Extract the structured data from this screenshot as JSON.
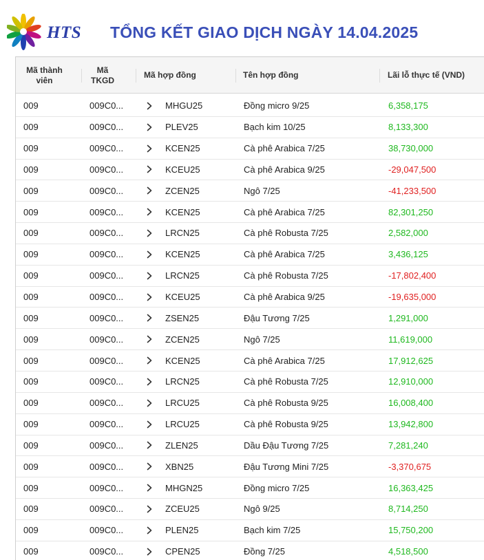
{
  "header": {
    "logo_text": "HTS",
    "title": "TỔNG KẾT GIAO DỊCH NGÀY 14.04.2025"
  },
  "colors": {
    "positive": "#1eb81e",
    "negative": "#e02020",
    "title": "#3a4fb8"
  },
  "table": {
    "headers": {
      "member": "Mã thành viên",
      "account": "Mã TKGD",
      "contract_code": "Mã hợp đồng",
      "contract_name": "Tên hợp đồng",
      "pnl": "Lãi lỗ thực tế (VND)"
    },
    "rows": [
      {
        "member": "009",
        "account": "009C0...",
        "code": "MHGU25",
        "name": "Đồng micro 9/25",
        "pnl": "6,358,175",
        "sign": "pos"
      },
      {
        "member": "009",
        "account": "009C0...",
        "code": "PLEV25",
        "name": "Bạch kim 10/25",
        "pnl": "8,133,300",
        "sign": "pos"
      },
      {
        "member": "009",
        "account": "009C0...",
        "code": "KCEN25",
        "name": "Cà phê Arabica 7/25",
        "pnl": "38,730,000",
        "sign": "pos"
      },
      {
        "member": "009",
        "account": "009C0...",
        "code": "KCEU25",
        "name": "Cà phê Arabica 9/25",
        "pnl": "-29,047,500",
        "sign": "neg"
      },
      {
        "member": "009",
        "account": "009C0...",
        "code": "ZCEN25",
        "name": "Ngô 7/25",
        "pnl": "-41,233,500",
        "sign": "neg"
      },
      {
        "member": "009",
        "account": "009C0...",
        "code": "KCEN25",
        "name": "Cà phê Arabica 7/25",
        "pnl": "82,301,250",
        "sign": "pos"
      },
      {
        "member": "009",
        "account": "009C0...",
        "code": "LRCN25",
        "name": "Cà phê Robusta 7/25",
        "pnl": "2,582,000",
        "sign": "pos"
      },
      {
        "member": "009",
        "account": "009C0...",
        "code": "KCEN25",
        "name": "Cà phê Arabica 7/25",
        "pnl": "3,436,125",
        "sign": "pos"
      },
      {
        "member": "009",
        "account": "009C0...",
        "code": "LRCN25",
        "name": "Cà phê Robusta 7/25",
        "pnl": "-17,802,400",
        "sign": "neg"
      },
      {
        "member": "009",
        "account": "009C0...",
        "code": "KCEU25",
        "name": "Cà phê Arabica 9/25",
        "pnl": "-19,635,000",
        "sign": "neg"
      },
      {
        "member": "009",
        "account": "009C0...",
        "code": "ZSEN25",
        "name": "Đậu Tương 7/25",
        "pnl": "1,291,000",
        "sign": "pos"
      },
      {
        "member": "009",
        "account": "009C0...",
        "code": "ZCEN25",
        "name": "Ngô 7/25",
        "pnl": "11,619,000",
        "sign": "pos"
      },
      {
        "member": "009",
        "account": "009C0...",
        "code": "KCEN25",
        "name": "Cà phê Arabica 7/25",
        "pnl": "17,912,625",
        "sign": "pos"
      },
      {
        "member": "009",
        "account": "009C0...",
        "code": "LRCN25",
        "name": "Cà phê Robusta 7/25",
        "pnl": "12,910,000",
        "sign": "pos"
      },
      {
        "member": "009",
        "account": "009C0...",
        "code": "LRCU25",
        "name": "Cà phê Robusta 9/25",
        "pnl": "16,008,400",
        "sign": "pos"
      },
      {
        "member": "009",
        "account": "009C0...",
        "code": "LRCU25",
        "name": "Cà phê Robusta 9/25",
        "pnl": "13,942,800",
        "sign": "pos"
      },
      {
        "member": "009",
        "account": "009C0...",
        "code": "ZLEN25",
        "name": "Dầu Đậu Tương 7/25",
        "pnl": "7,281,240",
        "sign": "pos"
      },
      {
        "member": "009",
        "account": "009C0...",
        "code": "XBN25",
        "name": "Đậu Tương Mini 7/25",
        "pnl": "-3,370,675",
        "sign": "neg"
      },
      {
        "member": "009",
        "account": "009C0...",
        "code": "MHGN25",
        "name": "Đồng micro 7/25",
        "pnl": "16,363,425",
        "sign": "pos"
      },
      {
        "member": "009",
        "account": "009C0...",
        "code": "ZCEU25",
        "name": "Ngô 9/25",
        "pnl": "8,714,250",
        "sign": "pos"
      },
      {
        "member": "009",
        "account": "009C0...",
        "code": "PLEN25",
        "name": "Bạch kim 7/25",
        "pnl": "15,750,200",
        "sign": "pos"
      },
      {
        "member": "009",
        "account": "009C0...",
        "code": "CPEN25",
        "name": "Đồng 7/25",
        "pnl": "4,518,500",
        "sign": "pos"
      }
    ]
  }
}
